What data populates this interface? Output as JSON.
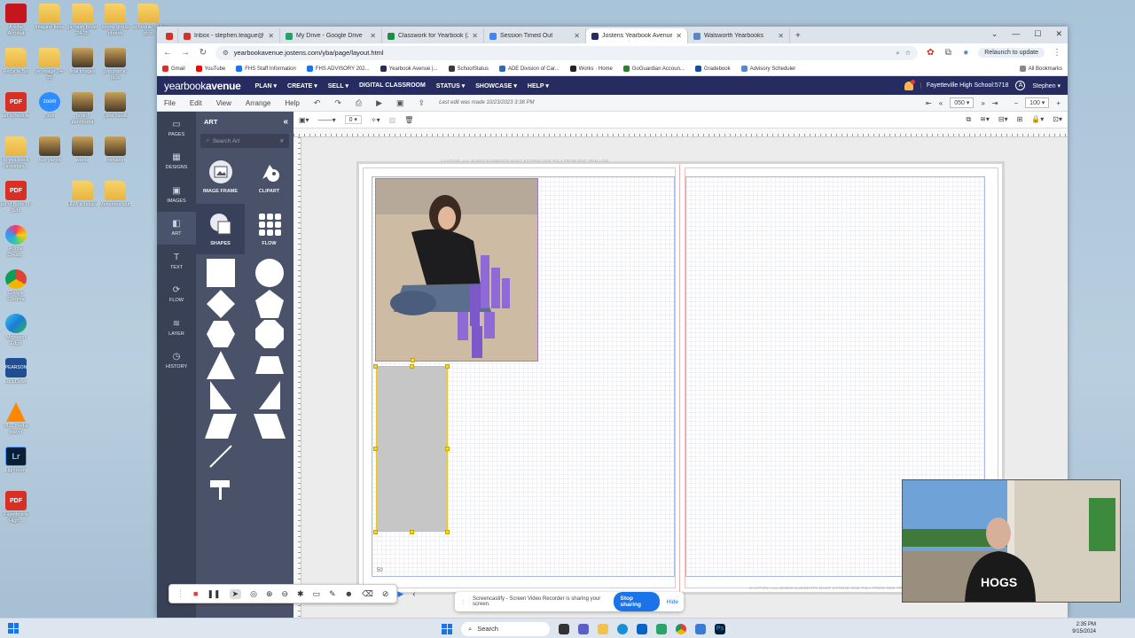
{
  "desktop": {
    "icons_col1": [
      {
        "label": "Adobe Acrobat",
        "kind": "acro"
      },
      {
        "label": "Recycle Bin",
        "kind": "folder"
      },
      {
        "label": "art schedule",
        "kind": "pdf"
      },
      {
        "label": "to yearbook candidate...",
        "kind": "folder"
      },
      {
        "label": "art of Buss Pt-Sch.",
        "kind": "pdf"
      },
      {
        "label": "Adobe Creati...",
        "kind": "cc"
      },
      {
        "label": "Google Chrome",
        "kind": "chrome"
      },
      {
        "label": "Microsoft Edge",
        "kind": "edge"
      },
      {
        "label": "LockDown",
        "kind": "pearson"
      },
      {
        "label": "VLC media player",
        "kind": "vlc"
      },
      {
        "label": "Lightroom",
        "kind": "lr"
      },
      {
        "label": "Fayetteville High...",
        "kind": "pdf"
      }
    ],
    "icons_col2": [
      {
        "label": "Imagine fonts",
        "kind": "folder"
      },
      {
        "label": "ye image 24-25",
        "kind": "folder"
      },
      {
        "label": "Zoom",
        "kind": "zoom"
      },
      {
        "label": "bus yanya",
        "kind": "photo"
      },
      {
        "label": "",
        "kind": "none"
      }
    ],
    "icons_col3": [
      {
        "label": "ga trash folder 24-25",
        "kind": "folder"
      },
      {
        "label": "final images",
        "kind": "photo"
      },
      {
        "label": "board panorama",
        "kind": "photo"
      },
      {
        "label": "wards",
        "kind": "photo"
      },
      {
        "label": "HMA scholars",
        "kind": "folder"
      }
    ],
    "icons_col4": [
      {
        "label": "sports group photos",
        "kind": "folder"
      },
      {
        "label": "panoramic pics",
        "kind": "photo"
      },
      {
        "label": "Lane swalk",
        "kind": "photo"
      },
      {
        "label": "Invitation",
        "kind": "photo"
      },
      {
        "label": "Memories stuff",
        "kind": "folder"
      }
    ],
    "icons_col5": [
      {
        "label": "schedule club pics",
        "kind": "folder"
      }
    ]
  },
  "browser": {
    "tabs": [
      {
        "title": "",
        "color": "#d93025"
      },
      {
        "title": "Inbox - stephen.teague@fayv...",
        "color": "#d93025"
      },
      {
        "title": "My Drive - Google Drive",
        "color": "#1fa463"
      },
      {
        "title": "Classwork for Yearbook (24-25)",
        "color": "#1e8e3e"
      },
      {
        "title": "Session Timed Out",
        "color": "#4285f4"
      },
      {
        "title": "Jostens Yearbook Avenue: Layo...",
        "color": "#262c60"
      },
      {
        "title": "Walsworth Yearbooks",
        "color": "#5b87c9"
      }
    ],
    "url": "yearbookavenue.jostens.com/yba/page/layout.html",
    "relaunch": "Relaunch to update",
    "bookmarks": [
      "Gmail",
      "YouTube",
      "FHS Staff Information",
      "FHS ADVISORY 202...",
      "Yearbook Avenue |...",
      "SchoolStatus",
      "ADE Division of Car...",
      "Works · Home",
      "GoGuardian Accoun...",
      "Gradebook",
      "Advisory Scheduler"
    ],
    "all_bookmarks": "All Bookmarks"
  },
  "app": {
    "logo_bold": "yearbook",
    "logo_rest": "avenue",
    "menu": [
      "PLAN ▾",
      "CREATE ▾",
      "SELL ▾",
      "DIGITAL CLASSROOM",
      "STATUS ▾",
      "SHOWCASE ▾",
      "HELP ▾"
    ],
    "school": "Fayetteville High School:5718",
    "user": "Stephen ▾",
    "submenu": [
      "File",
      "Edit",
      "View",
      "Arrange",
      "Help"
    ],
    "last_edit": "Last edit was made 10/23/2023 3:38 PM",
    "page_select": "050",
    "zoom_select": "100"
  },
  "sidebar": {
    "items": [
      {
        "label": "PAGES",
        "glyph": "▭"
      },
      {
        "label": "DESIGNS",
        "glyph": "▦"
      },
      {
        "label": "IMAGES",
        "glyph": "▣"
      },
      {
        "label": "ART",
        "glyph": "◧"
      },
      {
        "label": "TEXT",
        "glyph": "T"
      },
      {
        "label": "FLOW",
        "glyph": "⟳"
      },
      {
        "label": "LAYER",
        "glyph": "≋"
      },
      {
        "label": "HISTORY",
        "glyph": "◷"
      }
    ]
  },
  "art_panel": {
    "title": "ART",
    "search_placeholder": "Search Art",
    "categories": [
      "IMAGE FRAME",
      "CLIPART",
      "SHAPES",
      "FLOW"
    ]
  },
  "canvas": {
    "caution_top": "CAUTION: ALL BLEED ELEMENTS MUST EXTEND ONE PICA FROM RED TRIM LINE",
    "caution_bottom": "CAUTION: ALL BLEED ELEMENTS MUST EXTEND ONE PICA FROM RED TRIM LINE",
    "page_number": "50"
  },
  "recorder": {
    "share_text": "Screencastify - Screen Video Recorder is sharing your screen.",
    "stop_label": "Stop sharing",
    "hide_label": "Hide"
  },
  "taskbar": {
    "search_placeholder": "Search",
    "time": "2:35 PM",
    "date": "9/15/2024"
  }
}
